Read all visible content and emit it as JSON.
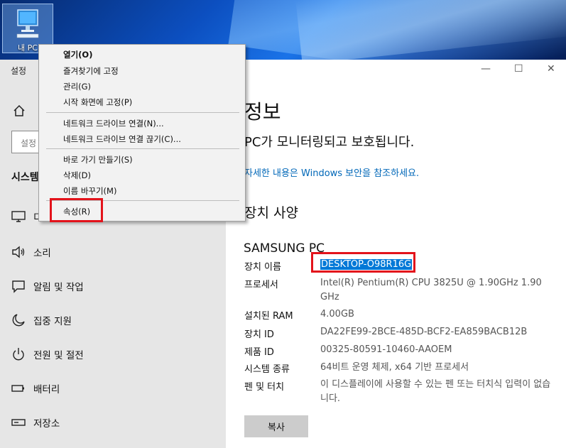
{
  "desktop": {
    "icon_label": "내 PC"
  },
  "window": {
    "title": "설정",
    "search_placeholder": "설정",
    "section_heading": "시스템"
  },
  "nav": {
    "items": [
      {
        "label": "디스플레이",
        "icon": "monitor-icon"
      },
      {
        "label": "소리",
        "icon": "speaker-icon"
      },
      {
        "label": "알림 및 작업",
        "icon": "message-icon"
      },
      {
        "label": "집중 지원",
        "icon": "moon-icon"
      },
      {
        "label": "전원 및 절전",
        "icon": "power-icon"
      },
      {
        "label": "배터리",
        "icon": "battery-icon"
      },
      {
        "label": "저장소",
        "icon": "storage-icon"
      }
    ]
  },
  "main": {
    "heading": "정보",
    "protect_text": "PC가 모니터링되고 보호됩니다.",
    "security_link": "자세한 내용은 Windows 보안을 참조하세요.",
    "spec_heading": "장치 사양",
    "device_name": "SAMSUNG PC",
    "copy_button": "복사"
  },
  "specs": {
    "device_name": {
      "label": "장치 이름",
      "value": "DESKTOP-O98R16G"
    },
    "processor": {
      "label": "프로세서",
      "value": "Intel(R) Pentium(R) CPU 3825U @ 1.90GHz   1.90 GHz"
    },
    "ram": {
      "label": "설치된 RAM",
      "value": "4.00GB"
    },
    "device_id": {
      "label": "장치 ID",
      "value": "DA22FE99-2BCE-485D-BCF2-EA859BACB12B"
    },
    "product_id": {
      "label": "제품 ID",
      "value": "00325-80591-10460-AAOEM"
    },
    "system_type": {
      "label": "시스템 종류",
      "value": "64비트 운영 체제, x64 기반 프로세서"
    },
    "pen_touch": {
      "label": "펜 및 터치",
      "value": "이 디스플레이에 사용할 수 있는 펜 또는 터치식 입력이 없습니다."
    }
  },
  "context_menu": {
    "open": "열기(O)",
    "pin_quick": "즐겨찾기에 고정",
    "manage": "관리(G)",
    "pin_start": "시작 화면에 고정(P)",
    "map_drive": "네트워크 드라이브 연결(N)...",
    "disconnect_drive": "네트워크 드라이브 연결 끊기(C)...",
    "create_shortcut": "바로 가기 만들기(S)",
    "delete": "삭제(D)",
    "rename": "이름 바꾸기(M)",
    "properties": "속성(R)"
  },
  "colors": {
    "highlight": "#e3131b",
    "link": "#0067b8",
    "selection": "#0078d7"
  }
}
